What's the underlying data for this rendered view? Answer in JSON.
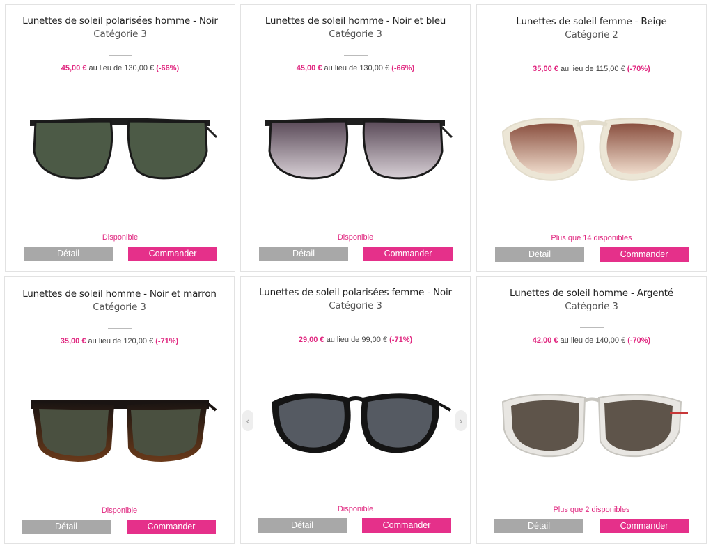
{
  "products": [
    {
      "title": "Lunettes de soleil polarisées homme - Noir",
      "category": "Catégorie 3",
      "price_now": "45,00 €",
      "price_label": "au lieu de",
      "price_old": "130,00 €",
      "discount": "(-66%)",
      "availability": "Disponible",
      "detail_label": "Détail",
      "order_label": "Commander"
    },
    {
      "title": "Lunettes de soleil homme - Noir et bleu",
      "category": "Catégorie 3",
      "price_now": "45,00 €",
      "price_label": "au lieu de",
      "price_old": "130,00 €",
      "discount": "(-66%)",
      "availability": "Disponible",
      "detail_label": "Détail",
      "order_label": "Commander"
    },
    {
      "title": "Lunettes de soleil femme - Beige",
      "category": "Catégorie 2",
      "price_now": "35,00 €",
      "price_label": "au lieu de",
      "price_old": "115,00 €",
      "discount": "(-70%)",
      "availability": "Plus que 14 disponibles",
      "detail_label": "Détail",
      "order_label": "Commander"
    },
    {
      "title": "Lunettes de soleil homme - Noir et marron",
      "category": "Catégorie 3",
      "price_now": "35,00 €",
      "price_label": "au lieu de",
      "price_old": "120,00 €",
      "discount": "(-71%)",
      "availability": "Disponible",
      "detail_label": "Détail",
      "order_label": "Commander"
    },
    {
      "title": "Lunettes de soleil polarisées femme - Noir",
      "category": "Catégorie 3",
      "price_now": "29,00 €",
      "price_label": "au lieu de",
      "price_old": "99,00 €",
      "discount": "(-71%)",
      "availability": "Disponible",
      "detail_label": "Détail",
      "order_label": "Commander"
    },
    {
      "title": "Lunettes de soleil homme - Argenté",
      "category": "Catégorie 3",
      "price_now": "42,00 €",
      "price_label": "au lieu de",
      "price_old": "140,00 €",
      "discount": "(-70%)",
      "availability": "Plus que 2 disponibles",
      "detail_label": "Détail",
      "order_label": "Commander"
    }
  ],
  "carousel": {
    "prev_icon": "‹",
    "next_icon": "›"
  },
  "colors": {
    "accent": "#e5308a",
    "price": "#e0267f",
    "detail_button": "#a8a8a8"
  }
}
